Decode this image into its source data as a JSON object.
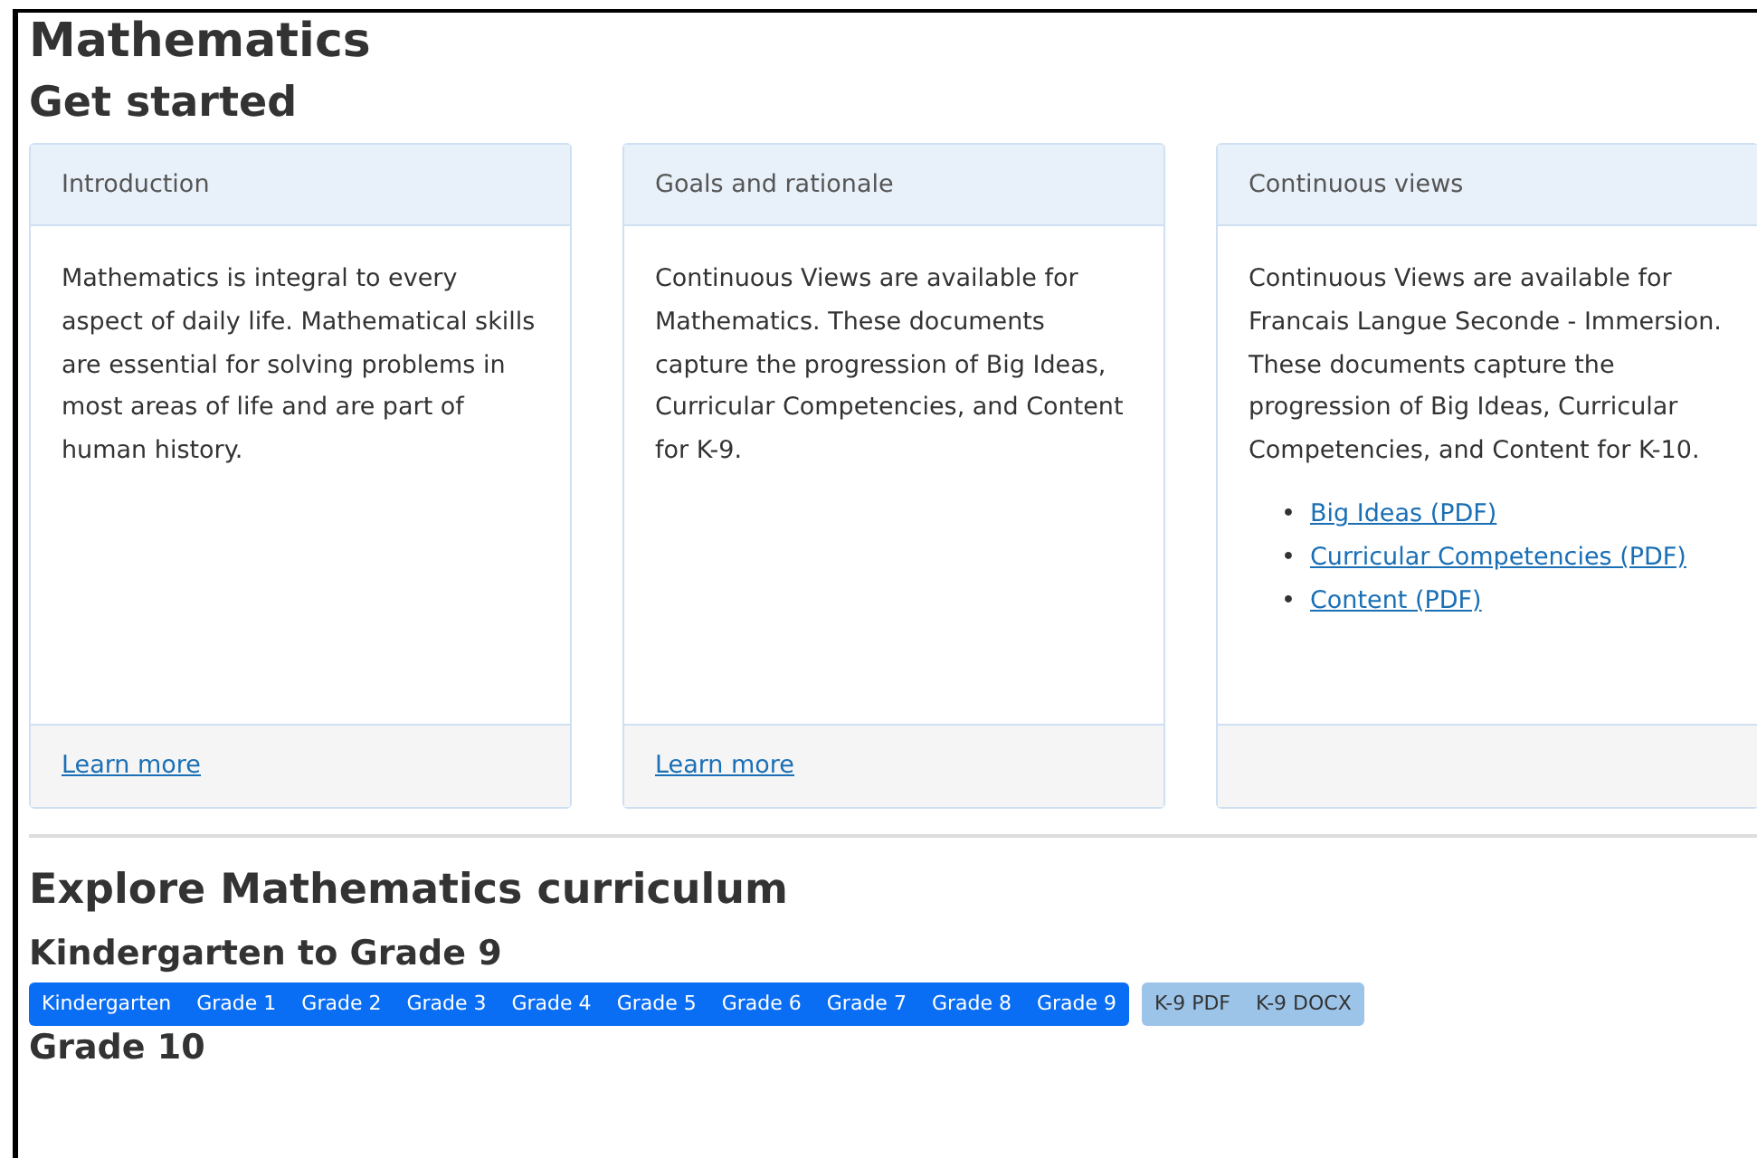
{
  "title": "Mathematics",
  "get_started": {
    "heading": "Get started",
    "cards": [
      {
        "header": "Introduction",
        "body": "Mathematics is integral to every aspect of daily life. Mathematical skills are essential for solving problems in most areas of life and are part of human history.",
        "footer_link": "Learn more"
      },
      {
        "header": "Goals and rationale",
        "body": "Continuous Views are available for Mathematics. These documents capture the progression of Big Ideas, Curricular Competencies, and Content for K-9.",
        "footer_link": "Learn more"
      },
      {
        "header": "Continuous views",
        "body": "Continuous Views are available for Francais Langue Seconde - Immersion. These documents capture the progression of Big Ideas, Curricular Competencies, and Content for K-10.",
        "links": [
          {
            "bullet": "•",
            "text": "Big Ideas (PDF)"
          },
          {
            "bullet": "•",
            "text": "Curricular Competencies (PDF)"
          },
          {
            "bullet": "•",
            "text": "Content (PDF)"
          }
        ]
      }
    ]
  },
  "explore": {
    "heading": "Explore Mathematics curriculum",
    "sections": [
      {
        "heading": "Kindergarten to Grade 9",
        "grades": [
          "Kindergarten",
          "Grade 1",
          "Grade 2",
          "Grade 3",
          "Grade 4",
          "Grade 5",
          "Grade 6",
          "Grade 7",
          "Grade 8",
          "Grade 9"
        ],
        "downloads": [
          "K-9 PDF",
          "K-9 DOCX"
        ]
      },
      {
        "heading": "Grade 10"
      }
    ]
  }
}
